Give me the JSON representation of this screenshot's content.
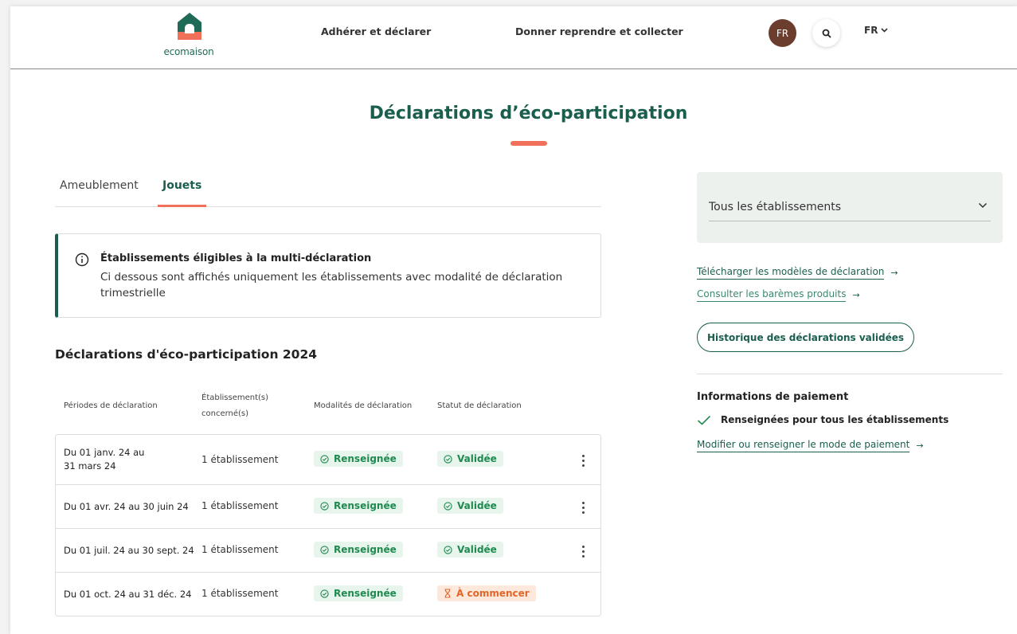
{
  "header": {
    "logo_text": "ecomaison",
    "nav": [
      "Adhérer et déclarer",
      "Donner reprendre et collecter"
    ],
    "avatar_initials": "FR",
    "lang": "FR"
  },
  "page": {
    "title": "Déclarations d’éco-participation"
  },
  "tabs": [
    {
      "label": "Ameublement",
      "active": false
    },
    {
      "label": "Jouets",
      "active": true
    }
  ],
  "info": {
    "title": "Établissements éligibles à la multi-déclaration",
    "text": "Ci dessous sont affichés uniquement les établissements avec modalité de déclaration trimestrielle"
  },
  "section": {
    "title": "Déclarations d'éco-participation 2024",
    "headers": [
      "Périodes de déclaration",
      "Établissement(s) concerné(s)",
      "Modalités de déclaration",
      "Statut de déclaration"
    ]
  },
  "rows": [
    {
      "period": "Du 01 janv. 24 au 31 mars 24",
      "establishments": "1 établissement",
      "modality": "Renseignée",
      "status": "Validée",
      "status_type": "validated"
    },
    {
      "period": "Du 01 avr. 24 au 30 juin 24",
      "establishments": "1 établissement",
      "modality": "Renseignée",
      "status": "Validée",
      "status_type": "validated"
    },
    {
      "period": "Du 01 juil. 24 au 30 sept. 24",
      "establishments": "1 établissement",
      "modality": "Renseignée",
      "status": "Validée",
      "status_type": "validated"
    },
    {
      "period": "Du 01 oct. 24 au 31 déc. 24",
      "establishments": "1 établissement",
      "modality": "Renseignée",
      "status": "À commencer",
      "status_type": "pending"
    }
  ],
  "sidebar": {
    "filter_label": "Tous les établissements",
    "link_templates": "Télécharger les modèles de déclaration",
    "link_rates": "Consulter les barèmes produits",
    "history_button": "Historique des déclarations validées",
    "payment_title": "Informations de paiement",
    "payment_status": "Renseignées pour tous les établissements",
    "payment_link": "Modifier ou renseigner le mode de paiement"
  },
  "colors": {
    "brand": "#1a5e4d",
    "accent": "#f0705a",
    "success": "#1e8a4f",
    "pending": "#e2662a"
  }
}
